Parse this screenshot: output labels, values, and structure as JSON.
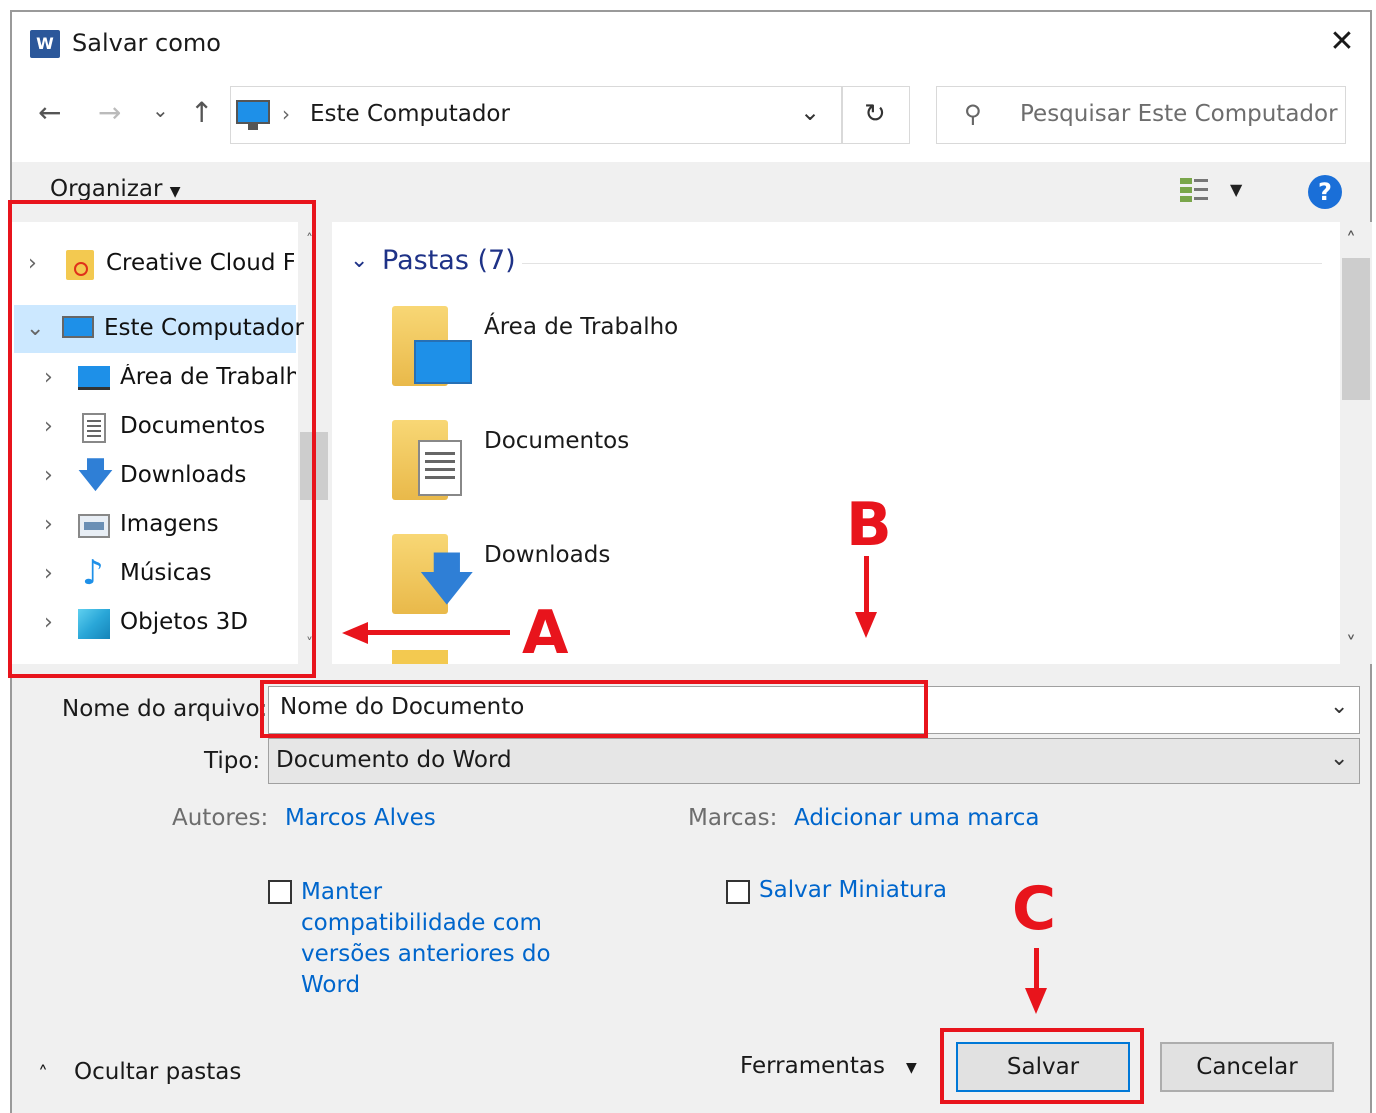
{
  "window": {
    "title": "Salvar como",
    "app_icon_letter": "W"
  },
  "nav": {
    "back": "←",
    "forward": "→",
    "recent": "⌄",
    "up": "↑",
    "address": "Este Computador",
    "refresh": "↻",
    "search_placeholder": "Pesquisar Este Computador"
  },
  "toolbar": {
    "organize": "Organizar",
    "help": "?"
  },
  "tree": [
    {
      "label": "Creative Cloud Fil",
      "icon": "creative-cloud-icon"
    },
    {
      "label": "Este Computador",
      "icon": "computer-icon"
    },
    {
      "label": "Área de Trabalhc",
      "icon": "desktop-icon"
    },
    {
      "label": "Documentos",
      "icon": "documents-icon"
    },
    {
      "label": "Downloads",
      "icon": "downloads-icon"
    },
    {
      "label": "Imagens",
      "icon": "pictures-icon"
    },
    {
      "label": "Músicas",
      "icon": "music-icon"
    },
    {
      "label": "Objetos 3D",
      "icon": "3d-objects-icon"
    }
  ],
  "content": {
    "group_title": "Pastas (7)",
    "folders": [
      {
        "label": "Área de Trabalho"
      },
      {
        "label": "Documentos"
      },
      {
        "label": "Downloads"
      }
    ]
  },
  "form": {
    "filename_label": "Nome do arquivo:",
    "filename_value": "Nome do Documento",
    "type_label": "Tipo:",
    "type_value": "Documento do Word",
    "authors_label": "Autores:",
    "authors_value": "Marcos Alves",
    "tags_label": "Marcas:",
    "tags_value": "Adicionar uma marca",
    "compat_line1": "Manter",
    "compat_line2": "compatibilidade com",
    "compat_line3": "versões anteriores do",
    "compat_line4": "Word",
    "thumbnail": "Salvar Miniatura"
  },
  "footer": {
    "hide_folders": "Ocultar pastas",
    "tools": "Ferramentas",
    "save": "Salvar",
    "cancel": "Cancelar"
  },
  "annotations": {
    "a": "A",
    "b": "B",
    "c": "C",
    "color": "#e8141c"
  }
}
